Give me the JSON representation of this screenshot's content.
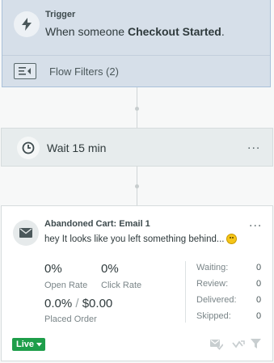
{
  "trigger": {
    "label": "Trigger",
    "text_prefix": "When someone ",
    "event": "Checkout Started",
    "text_suffix": ".",
    "filters_label": "Flow Filters (2)",
    "icon": "lightning-icon"
  },
  "wait": {
    "label": "Wait 15 min",
    "icon": "clock-icon",
    "menu": "..."
  },
  "email": {
    "title": "Abandoned Cart: Email 1",
    "preview": "hey It looks like you left something behind...",
    "icon": "envelope-icon",
    "menu": "...",
    "open_rate_value": "0%",
    "open_rate_label": "Open Rate",
    "click_rate_value": "0%",
    "click_rate_label": "Click Rate",
    "placed_order_pct": "0.0%",
    "placed_order_sep": "/",
    "placed_order_amount": "$0.00",
    "placed_order_label": "Placed Order",
    "side_stats": [
      {
        "label": "Waiting:",
        "value": "0"
      },
      {
        "label": "Review:",
        "value": "0"
      },
      {
        "label": "Delivered:",
        "value": "0"
      },
      {
        "label": "Skipped:",
        "value": "0"
      }
    ],
    "status_label": "Live",
    "status_color": "#1e9e4a"
  }
}
